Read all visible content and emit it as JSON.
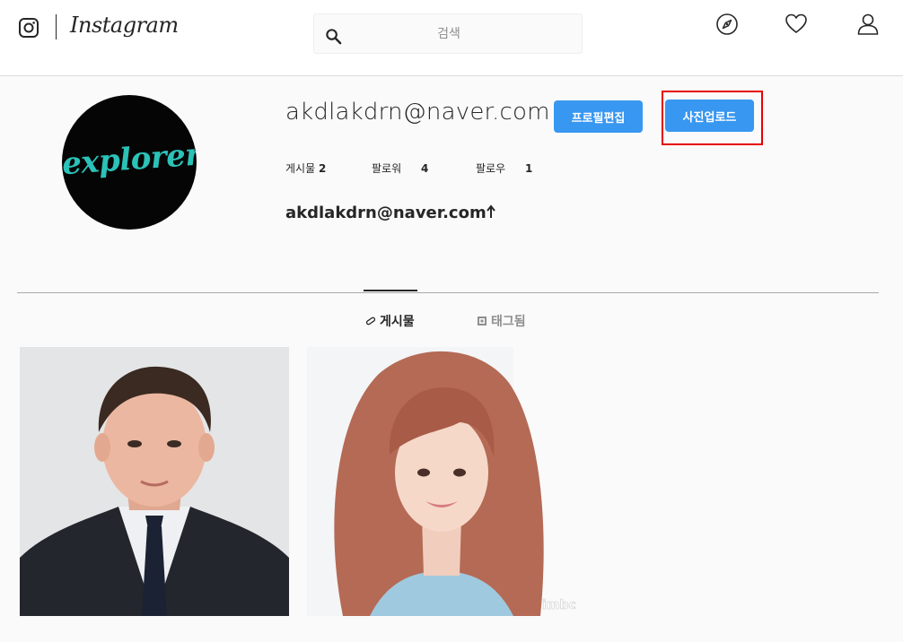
{
  "header": {
    "logo_text": "Instagram",
    "search": {
      "placeholder": "검색"
    },
    "icons": [
      "instagram-glyph-icon",
      "search-icon",
      "compass-icon",
      "heart-icon",
      "profile-icon"
    ]
  },
  "profile": {
    "username": "akdlakdrn@naver.com",
    "avatar_text": "explorer",
    "edit_profile_label": "프로필편집",
    "upload_photo_label": "사진업로드",
    "stats": {
      "posts_label": "게시물",
      "posts_count": "2",
      "followers_label": "팔로워",
      "followers_count": "4",
      "following_label": "팔로우",
      "following_count": "1"
    },
    "display_name": "akdlakdrn@naver.com"
  },
  "tabs": [
    {
      "label": "게시물",
      "active": true,
      "icon": "posts-grid-icon"
    },
    {
      "label": "태그됨",
      "active": false,
      "icon": "tagged-icon"
    }
  ],
  "posts": [
    {
      "alt": "man in suit portrait"
    },
    {
      "alt": "woman portrait",
      "watermark": "imbc"
    }
  ],
  "colors": {
    "accent": "#3897f0",
    "highlight": "#e60000",
    "avatar_text": "#2bc2b8"
  }
}
